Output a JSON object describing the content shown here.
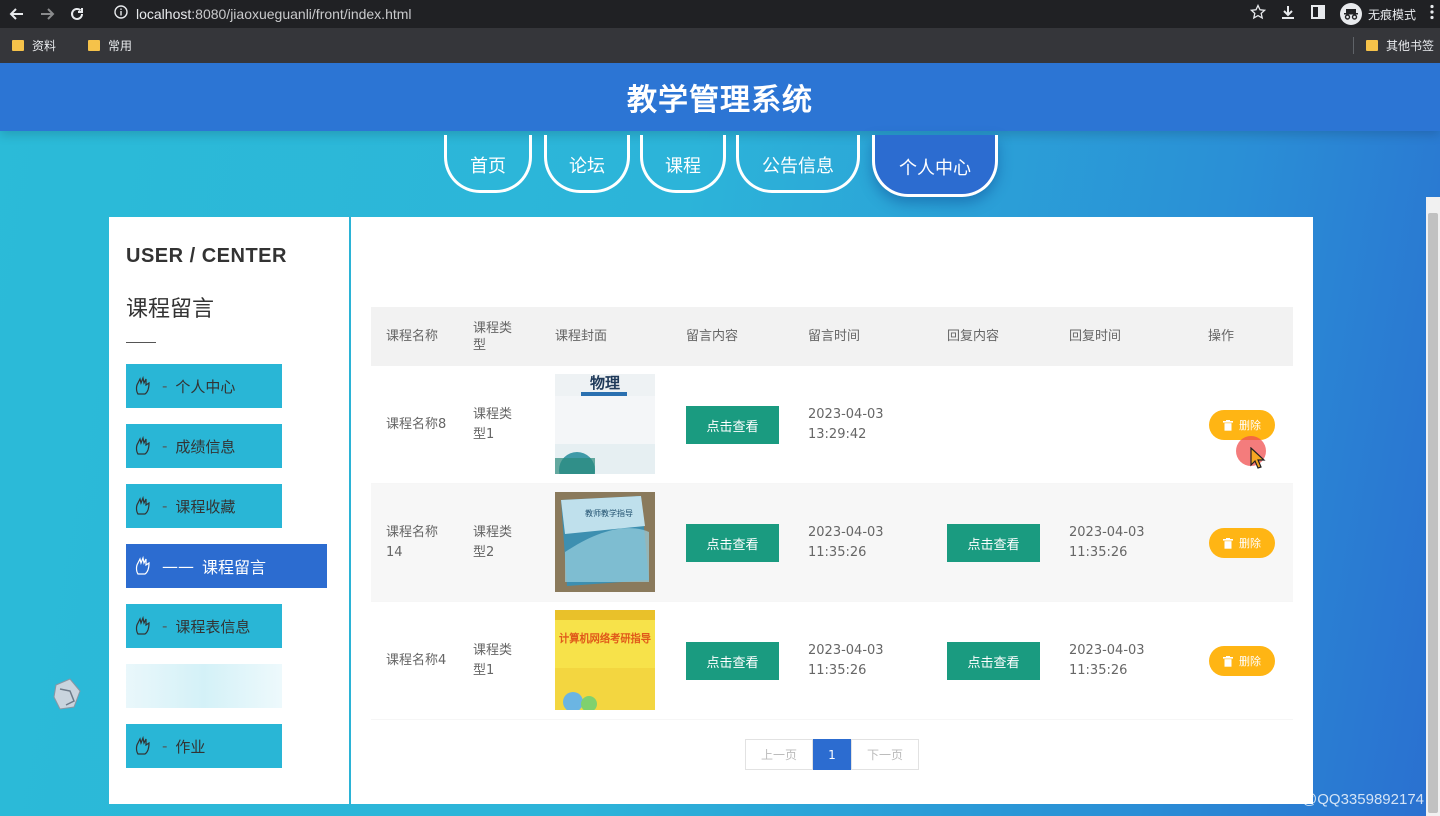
{
  "browser": {
    "url_host": "localhost",
    "url_rest": ":8080/jiaoxueguanli/front/index.html",
    "incognito_label": "无痕模式",
    "bookmarks": [
      "资料",
      "常用"
    ],
    "other_bookmarks": "其他书签"
  },
  "site": {
    "title": "教学管理系统",
    "nav": [
      "首页",
      "论坛",
      "课程",
      "公告信息",
      "个人中心"
    ],
    "nav_active": "个人中心"
  },
  "sidebar": {
    "eng_title": "USER / CENTER",
    "cn_title": "课程留言",
    "items": [
      {
        "label": "个人中心"
      },
      {
        "label": "成绩信息"
      },
      {
        "label": "课程收藏"
      },
      {
        "label": "课程留言",
        "active": true
      },
      {
        "label": "课程表信息"
      },
      {
        "label": ""
      },
      {
        "label": "作业"
      }
    ]
  },
  "table": {
    "headers": [
      "课程名称",
      "课程类型",
      "课程封面",
      "留言内容",
      "留言时间",
      "回复内容",
      "回复时间",
      "操作"
    ],
    "rows": [
      {
        "name": "课程名称8",
        "type": "课程类型1",
        "cover": "物理",
        "view_label": "点击查看",
        "time": "2023-04-03 13:29:42",
        "reply_label": "",
        "reply_time": "",
        "delete_label": "删除"
      },
      {
        "name": "课程名称14",
        "type": "课程类型2",
        "cover": "教师教学指导",
        "view_label": "点击查看",
        "time": "2023-04-03 11:35:26",
        "reply_label": "点击查看",
        "reply_time": "2023-04-03 11:35:26",
        "delete_label": "删除"
      },
      {
        "name": "课程名称4",
        "type": "课程类型1",
        "cover": "计算机网络考研指导",
        "view_label": "点击查看",
        "time": "2023-04-03 11:35:26",
        "reply_label": "点击查看",
        "reply_time": "2023-04-03 11:35:26",
        "delete_label": "删除"
      }
    ]
  },
  "pagination": {
    "prev": "上一页",
    "current": "1",
    "next": "下一页"
  },
  "watermark": "CSDN @QQ3359892174",
  "colors": {
    "header_blue": "#2c75d4",
    "accent_blue": "#2c6cd0",
    "cyan": "#29b6d6",
    "green": "#1a9b80",
    "orange": "#ffb514"
  }
}
